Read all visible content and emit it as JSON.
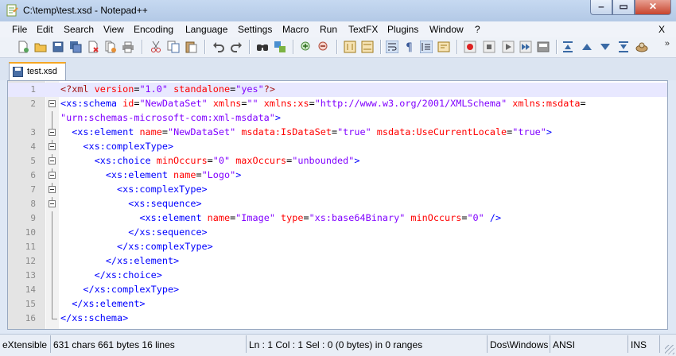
{
  "window": {
    "title": "C:\\temp\\test.xsd - Notepad++",
    "minimize_glyph": "‒",
    "maximize_glyph": "▭",
    "close_glyph": "✕"
  },
  "menu": {
    "items": [
      "File",
      "Edit",
      "Search",
      "View",
      "Encoding",
      "Language",
      "Settings",
      "Macro",
      "Run",
      "TextFX",
      "Plugins",
      "Window",
      "?"
    ],
    "close_label": "X"
  },
  "toolbar": {
    "icons": [
      "new-file-icon",
      "open-file-icon",
      "save-icon",
      "save-all-icon",
      "close-icon",
      "close-all-icon",
      "print-icon",
      "cut-icon",
      "copy-icon",
      "paste-icon",
      "undo-icon",
      "redo-icon",
      "find-icon",
      "replace-icon",
      "zoom-in-icon",
      "zoom-out-icon",
      "sync-vertical-icon",
      "sync-horizontal-icon",
      "word-wrap-icon",
      "show-all-chars-icon",
      "indent-guide-icon",
      "language-icon",
      "record-macro-icon",
      "stop-record-icon",
      "play-macro-icon",
      "run-macro-multiple-icon",
      "save-macro-icon",
      "collapse-icon",
      "up-icon",
      "down-icon",
      "expand-icon",
      "spellcheck-icon"
    ],
    "more_glyph": "»"
  },
  "tabs": [
    {
      "label": "test.xsd"
    }
  ],
  "editor": {
    "lines": [
      {
        "n": "1",
        "tokens": [
          [
            "pi",
            "<?xml "
          ],
          [
            "att",
            "version"
          ],
          [
            "eq",
            "="
          ],
          [
            "val",
            "\"1.0\""
          ],
          [
            "pi",
            " "
          ],
          [
            "att",
            "standalone"
          ],
          [
            "eq",
            "="
          ],
          [
            "val",
            "\"yes\""
          ],
          [
            "pi",
            "?>"
          ]
        ]
      },
      {
        "n": "2",
        "tokens": [
          [
            "tag",
            "<xs:schema "
          ],
          [
            "att",
            "id"
          ],
          [
            "eq",
            "="
          ],
          [
            "val",
            "\"NewDataSet\""
          ],
          [
            "tag",
            " "
          ],
          [
            "att",
            "xmlns"
          ],
          [
            "eq",
            "="
          ],
          [
            "val",
            "\"\""
          ],
          [
            "tag",
            " "
          ],
          [
            "att",
            "xmlns:xs"
          ],
          [
            "eq",
            "="
          ],
          [
            "val",
            "\"http://www.w3.org/2001/XMLSchema\""
          ],
          [
            "tag",
            " "
          ],
          [
            "att",
            "xmlns:msdata"
          ],
          [
            "eq",
            "="
          ]
        ]
      },
      {
        "n": "",
        "tokens": [
          [
            "val",
            "\"urn:schemas-microsoft-com:xml-msdata\""
          ],
          [
            "tag",
            ">"
          ]
        ]
      },
      {
        "n": "3",
        "tokens": [
          [
            "tag",
            "  <xs:element "
          ],
          [
            "att",
            "name"
          ],
          [
            "eq",
            "="
          ],
          [
            "val",
            "\"NewDataSet\""
          ],
          [
            "tag",
            " "
          ],
          [
            "att",
            "msdata:IsDataSet"
          ],
          [
            "eq",
            "="
          ],
          [
            "val",
            "\"true\""
          ],
          [
            "tag",
            " "
          ],
          [
            "att",
            "msdata:UseCurrentLocale"
          ],
          [
            "eq",
            "="
          ],
          [
            "val",
            "\"true\""
          ],
          [
            "tag",
            ">"
          ]
        ]
      },
      {
        "n": "4",
        "tokens": [
          [
            "tag",
            "    <xs:complexType>"
          ]
        ]
      },
      {
        "n": "5",
        "tokens": [
          [
            "tag",
            "      <xs:choice "
          ],
          [
            "att",
            "minOccurs"
          ],
          [
            "eq",
            "="
          ],
          [
            "val",
            "\"0\""
          ],
          [
            "tag",
            " "
          ],
          [
            "att",
            "maxOccurs"
          ],
          [
            "eq",
            "="
          ],
          [
            "val",
            "\"unbounded\""
          ],
          [
            "tag",
            ">"
          ]
        ]
      },
      {
        "n": "6",
        "tokens": [
          [
            "tag",
            "        <xs:element "
          ],
          [
            "att",
            "name"
          ],
          [
            "eq",
            "="
          ],
          [
            "val",
            "\"Logo\""
          ],
          [
            "tag",
            ">"
          ]
        ]
      },
      {
        "n": "7",
        "tokens": [
          [
            "tag",
            "          <xs:complexType>"
          ]
        ]
      },
      {
        "n": "8",
        "tokens": [
          [
            "tag",
            "            <xs:sequence>"
          ]
        ]
      },
      {
        "n": "9",
        "tokens": [
          [
            "tag",
            "              <xs:element "
          ],
          [
            "att",
            "name"
          ],
          [
            "eq",
            "="
          ],
          [
            "val",
            "\"Image\""
          ],
          [
            "tag",
            " "
          ],
          [
            "att",
            "type"
          ],
          [
            "eq",
            "="
          ],
          [
            "val",
            "\"xs:base64Binary\""
          ],
          [
            "tag",
            " "
          ],
          [
            "att",
            "minOccurs"
          ],
          [
            "eq",
            "="
          ],
          [
            "val",
            "\"0\""
          ],
          [
            "tag",
            " />"
          ]
        ]
      },
      {
        "n": "10",
        "tokens": [
          [
            "tag",
            "            </xs:sequence>"
          ]
        ]
      },
      {
        "n": "11",
        "tokens": [
          [
            "tag",
            "          </xs:complexType>"
          ]
        ]
      },
      {
        "n": "12",
        "tokens": [
          [
            "tag",
            "        </xs:element>"
          ]
        ]
      },
      {
        "n": "13",
        "tokens": [
          [
            "tag",
            "      </xs:choice>"
          ]
        ]
      },
      {
        "n": "14",
        "tokens": [
          [
            "tag",
            "    </xs:complexType>"
          ]
        ]
      },
      {
        "n": "15",
        "tokens": [
          [
            "tag",
            "  </xs:element>"
          ]
        ]
      },
      {
        "n": "16",
        "tokens": [
          [
            "tag",
            "</xs:schema>"
          ]
        ]
      }
    ]
  },
  "status": {
    "doc_type": "eXtensible",
    "length": "631 chars   661 bytes   16 lines",
    "position": "Ln : 1    Col : 1    Sel : 0 (0 bytes) in 0 ranges",
    "eol": "Dos\\Windows",
    "encoding": "ANSI",
    "mode": "INS"
  }
}
